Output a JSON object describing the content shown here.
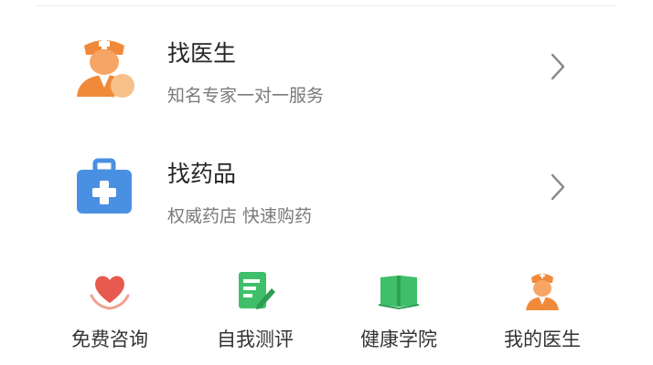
{
  "services": [
    {
      "title": "找医生",
      "subtitle": "知名专家一对一服务",
      "icon": "doctor-consult-icon"
    },
    {
      "title": "找药品",
      "subtitle": "权威药店 快速购药",
      "icon": "medical-kit-icon"
    }
  ],
  "quick_links": [
    {
      "label": "免费咨询",
      "icon": "heart-hands-icon"
    },
    {
      "label": "自我测评",
      "icon": "edit-document-icon"
    },
    {
      "label": "健康学院",
      "icon": "open-book-icon"
    },
    {
      "label": "我的医生",
      "icon": "nurse-icon"
    }
  ],
  "colors": {
    "orange": "#f08a3a",
    "blue": "#4a90e2",
    "red": "#e85a4f",
    "green": "#3fbf6a",
    "title_text": "#262626",
    "subtitle_text": "#7a7a7a"
  }
}
